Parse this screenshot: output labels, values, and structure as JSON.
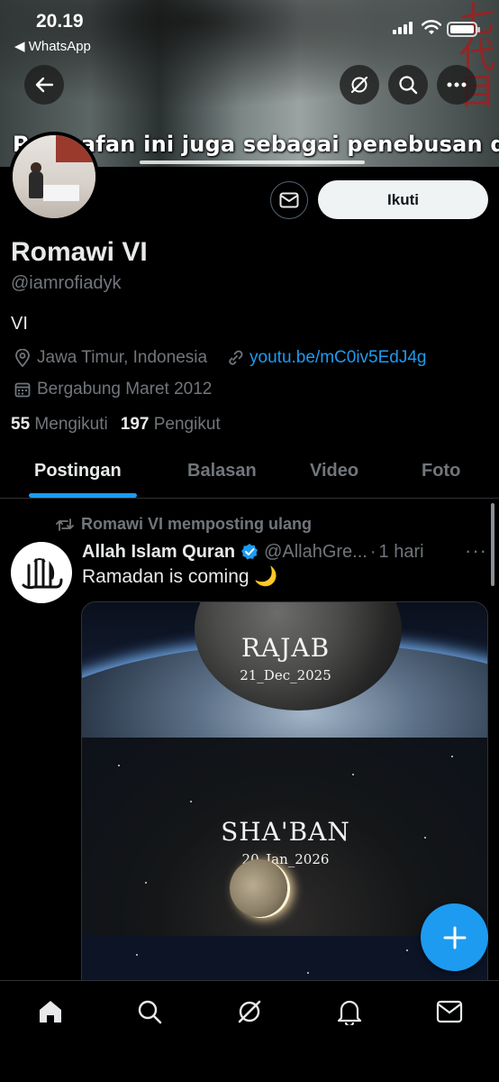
{
  "status_bar": {
    "time": "20.19",
    "back_app": "◀ WhatsApp"
  },
  "banner": {
    "subtitle": "Pemaafan ini juga sebagai penebusan dosaku.",
    "glyphs": "七代目"
  },
  "header": {
    "back_icon": "arrow-left-icon",
    "grok_icon": "grok-icon",
    "search_icon": "search-icon",
    "more_icon": "more-icon"
  },
  "profile": {
    "name": "Romawi VI",
    "handle": "@iamrofiadyk",
    "bio": "VI",
    "location": "Jawa Timur, Indonesia",
    "link": "youtu.be/mC0iv5EdJ4g",
    "joined": "Bergabung Maret 2012",
    "following_count": "55",
    "following_label": "Mengikuti",
    "followers_count": "197",
    "followers_label": "Pengikut",
    "follow_button": "Ikuti"
  },
  "tabs": [
    {
      "label": "Postingan",
      "active": true
    },
    {
      "label": "Balasan",
      "active": false
    },
    {
      "label": "Video",
      "active": false
    },
    {
      "label": "Foto",
      "active": false
    }
  ],
  "post": {
    "repost_label": "Romawi VI memposting ulang",
    "author": "Allah Islam Quran",
    "handle": "@AllahGre...",
    "separator": "·",
    "time": "1 hari",
    "text": "Ramadan is coming 🌙",
    "media": {
      "panel1_title": "RAJAB",
      "panel1_date": "21_Dec_2025",
      "panel2_title": "SHA'BAN",
      "panel2_date": "20_Jan_2026"
    }
  },
  "colors": {
    "accent": "#1d9bf0",
    "background": "#000000",
    "muted": "#71767b"
  },
  "bottom_nav": [
    "home-icon",
    "search-icon",
    "grok-icon",
    "notifications-icon",
    "messages-icon"
  ]
}
